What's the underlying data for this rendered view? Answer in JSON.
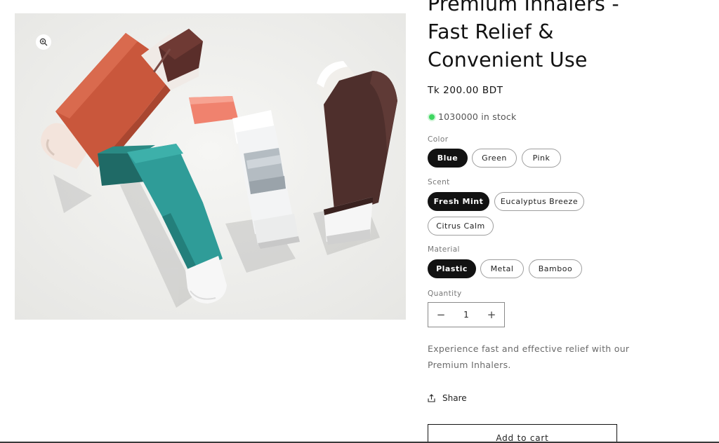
{
  "product": {
    "image_alt": "Four inhalers in red, teal, white and brown",
    "title_lines": [
      "Premium Inhalers -",
      "Fast Relief &",
      "Convenient Use"
    ],
    "price": "Tk 200.00 BDT",
    "stock_text": "1030000 in stock",
    "stock_color": "#3ed660",
    "description": "Experience fast and effective relief with our Premium Inhalers."
  },
  "options": {
    "color": {
      "label": "Color",
      "values": [
        "Blue",
        "Green",
        "Pink"
      ],
      "selected": "Blue"
    },
    "scent": {
      "label": "Scent",
      "values": [
        "Fresh Mint",
        "Eucalyptus Breeze",
        "Citrus Calm"
      ],
      "selected": "Fresh Mint"
    },
    "material": {
      "label": "Material",
      "values": [
        "Plastic",
        "Metal",
        "Bamboo"
      ],
      "selected": "Plastic"
    }
  },
  "quantity": {
    "label": "Quantity",
    "value": "1",
    "decrease_symbol": "−",
    "increase_symbol": "+"
  },
  "actions": {
    "share_label": "Share",
    "add_to_cart_label": "Add to cart"
  },
  "icons": {
    "zoom": "zoom-in-icon",
    "share": "share-icon"
  }
}
